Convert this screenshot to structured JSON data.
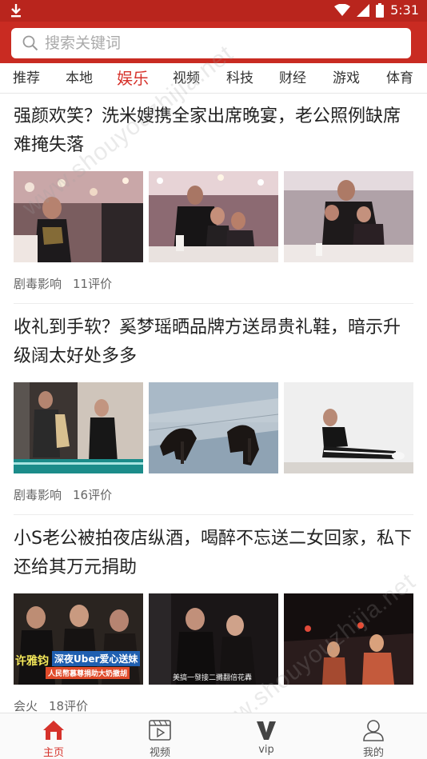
{
  "status_bar": {
    "download_icon": "download-icon",
    "time": "5:31"
  },
  "search": {
    "placeholder": "搜索关键词"
  },
  "tabs": [
    {
      "label": "推荐",
      "active": false
    },
    {
      "label": "本地",
      "active": false
    },
    {
      "label": "娱乐",
      "active": true
    },
    {
      "label": "视频",
      "active": false
    },
    {
      "label": "科技",
      "active": false
    },
    {
      "label": "财经",
      "active": false
    },
    {
      "label": "游戏",
      "active": false
    },
    {
      "label": "体育",
      "active": false
    }
  ],
  "articles": [
    {
      "title": "强颜欢笑？洗米嫂携全家出席晚宴，老公照例缺席难掩失落",
      "source": "剧毒影响",
      "comments": "11评价"
    },
    {
      "title": "收礼到手软？奚梦瑶晒品牌方送昂贵礼鞋，暗示升级阔太好处多多",
      "source": "剧毒影响",
      "comments": "16评价"
    },
    {
      "title": "小S老公被拍夜店纵酒，喝醉不忘送二女回家，私下还给其万元捐助",
      "source": "会火",
      "comments": "18评价"
    }
  ],
  "image_captions": {
    "a3_img1_line1": "许雅钧",
    "a3_img1_line2": "深夜Uber爱心送妹",
    "a3_img1_line3": "人民幣慕尊捐助大奶撤胡",
    "a3_img2_caption": "美搞一發接二攤翻倍花轟"
  },
  "bottom_nav": [
    {
      "label": "主页",
      "icon": "home-icon",
      "active": true
    },
    {
      "label": "视频",
      "icon": "video-icon",
      "active": false
    },
    {
      "label": "vip",
      "icon": "vip-icon",
      "active": false
    },
    {
      "label": "我的",
      "icon": "profile-icon",
      "active": false
    }
  ],
  "watermark": "www.shouyouzhijia.net",
  "colors": {
    "brand_red": "#c92b22",
    "status_red": "#b9251d",
    "active_tab": "#d6322b"
  }
}
